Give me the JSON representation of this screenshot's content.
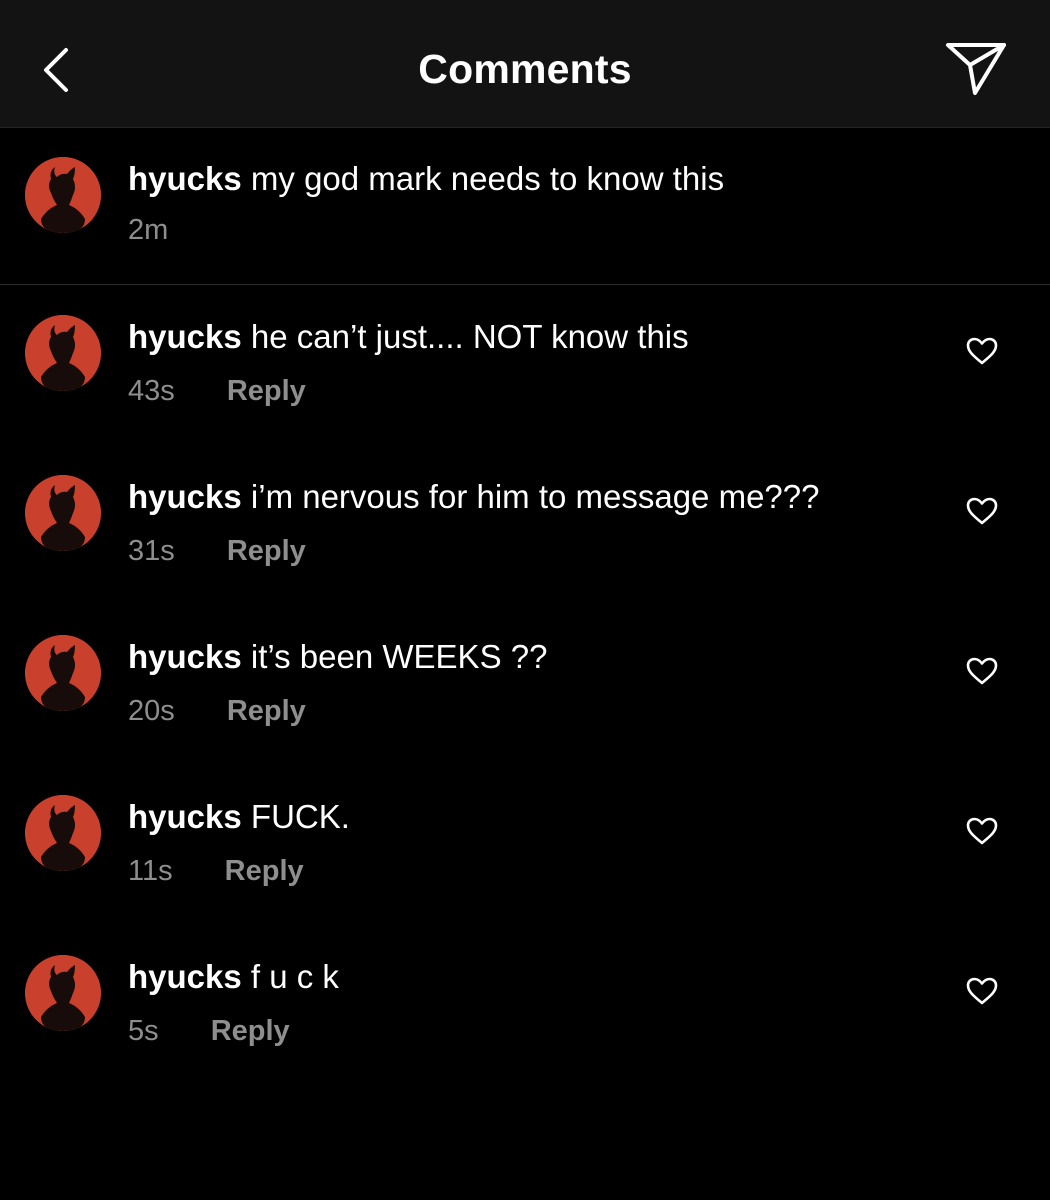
{
  "header": {
    "title": "Comments",
    "back_icon": "chevron-left-icon",
    "share_icon": "paper-plane-icon"
  },
  "caption": {
    "username": "hyucks",
    "text": "my god mark needs to know this",
    "time": "2m"
  },
  "comments": [
    {
      "username": "hyucks",
      "text": "he can’t just.... NOT know this",
      "time": "43s",
      "reply_label": "Reply"
    },
    {
      "username": "hyucks",
      "text": "i’m nervous for him to message me???",
      "time": "31s",
      "reply_label": "Reply"
    },
    {
      "username": "hyucks",
      "text": "it’s been WEEKS ??",
      "time": "20s",
      "reply_label": "Reply"
    },
    {
      "username": "hyucks",
      "text": "FUCK.",
      "time": "11s",
      "reply_label": "Reply"
    },
    {
      "username": "hyucks",
      "text": "f u c k",
      "time": "5s",
      "reply_label": "Reply"
    }
  ],
  "colors": {
    "background": "#000000",
    "header_background": "#131313",
    "secondary_text": "#8e8e8e",
    "avatar_red": "#c9412d"
  }
}
